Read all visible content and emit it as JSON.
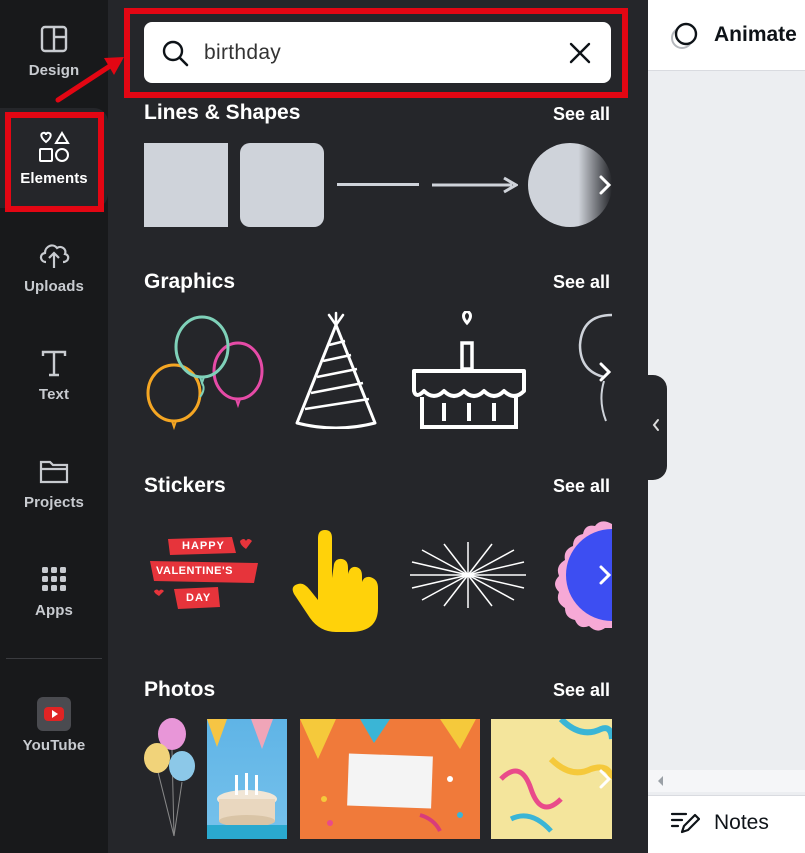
{
  "sidebar": {
    "items": [
      {
        "label": "Design",
        "icon": "layout-icon"
      },
      {
        "label": "Elements",
        "icon": "shapes-icon"
      },
      {
        "label": "Uploads",
        "icon": "cloud-upload-icon"
      },
      {
        "label": "Text",
        "icon": "text-icon"
      },
      {
        "label": "Projects",
        "icon": "folder-icon"
      },
      {
        "label": "Apps",
        "icon": "grid-icon"
      },
      {
        "label": "YouTube",
        "icon": "youtube-icon"
      }
    ],
    "active": "Elements"
  },
  "search": {
    "value": "birthday",
    "placeholder": ""
  },
  "sections": {
    "lines_shapes": {
      "title": "Lines & Shapes",
      "see_all": "See all"
    },
    "graphics": {
      "title": "Graphics",
      "see_all": "See all"
    },
    "stickers": {
      "title": "Stickers",
      "see_all": "See all"
    },
    "photos": {
      "title": "Photos",
      "see_all": "See all"
    }
  },
  "sticker_text": {
    "line1": "HAPPY",
    "line2": "VALENTINE'S",
    "line3": "DAY"
  },
  "editor": {
    "animate_label": "Animate",
    "notes_label": "Notes"
  },
  "colors": {
    "highlight": "#e30613",
    "panel_bg": "#25262a",
    "rail_bg": "#18191b"
  }
}
